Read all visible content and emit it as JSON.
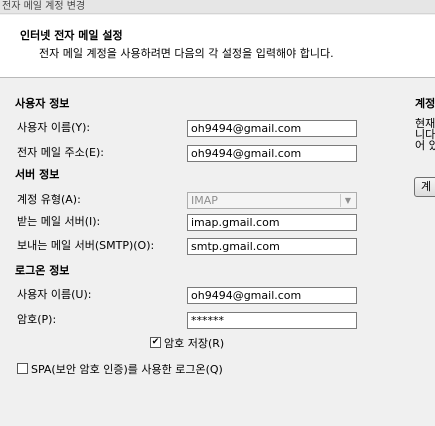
{
  "window": {
    "title": "전자 메일 계정 변경"
  },
  "header": {
    "title": "인터넷 전자 메일 설정",
    "subtitle": "전자 메일 계정을 사용하려면 다음의 각 설정을 입력해야 합니다."
  },
  "user_info": {
    "heading": "사용자 정보",
    "name_label": "사용자 이름(Y):",
    "name_value": "oh9494@gmail.com",
    "email_label": "전자 메일 주소(E):",
    "email_value": "oh9494@gmail.com"
  },
  "server_info": {
    "heading": "서버 정보",
    "account_type_label": "계정 유형(A):",
    "account_type_value": "IMAP",
    "incoming_label": "받는 메일 서버(I):",
    "incoming_value": "imap.gmail.com",
    "outgoing_label": "보내는 메일 서버(SMTP)(O):",
    "outgoing_value": "smtp.gmail.com"
  },
  "logon_info": {
    "heading": "로그온 정보",
    "username_label": "사용자 이름(U):",
    "username_value": "oh9494@gmail.com",
    "password_label": "암호(P):",
    "password_value": "******",
    "remember_password_label": "암호 저장(R)",
    "remember_password_checked": true,
    "spa_label": "SPA(보안 암호 인증)를 사용한 로그온(Q)",
    "spa_checked": false
  },
  "right_panel": {
    "heading": "계정",
    "lines": [
      "현재",
      "니다",
      "어 있"
    ],
    "button_label": "계"
  }
}
